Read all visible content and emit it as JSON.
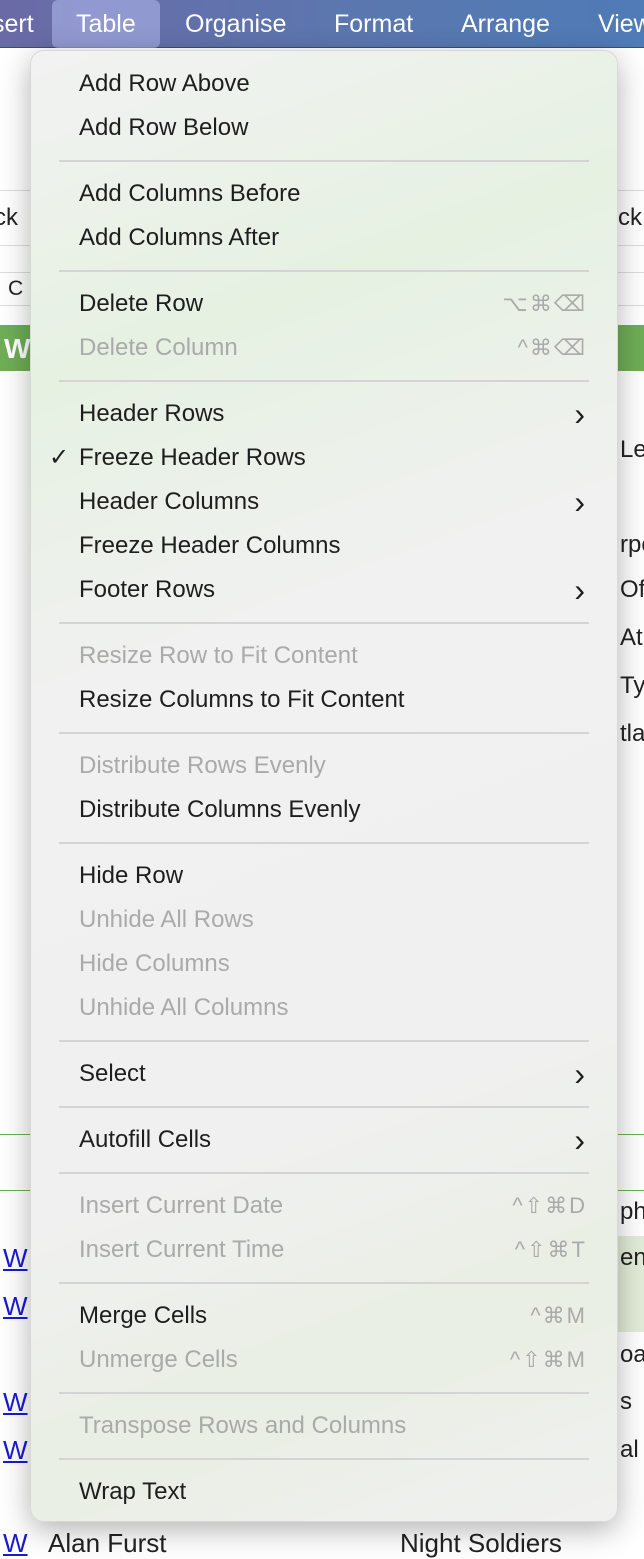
{
  "menubar": {
    "items": [
      {
        "label": "sert"
      },
      {
        "label": "Table",
        "active": true
      },
      {
        "label": "Organise"
      },
      {
        "label": "Format"
      },
      {
        "label": "Arrange"
      },
      {
        "label": "View"
      }
    ]
  },
  "background": {
    "left_fragments": [
      "ck",
      "C",
      "W"
    ],
    "right_fragments": [
      "ck",
      "Le",
      "rpo",
      "Of",
      "At",
      "Tyr",
      "tla",
      "ph",
      "en",
      "oa",
      "s",
      "al"
    ],
    "links": [
      "W",
      "W",
      "W",
      "W",
      "W"
    ],
    "last_row": {
      "author": "Alan Furst",
      "title": "Night Soldiers"
    },
    "accent": "#6fae56"
  },
  "menu": {
    "groups": [
      [
        {
          "label": "Add Row Above"
        },
        {
          "label": "Add Row Below"
        }
      ],
      [
        {
          "label": "Add Columns Before"
        },
        {
          "label": "Add Columns After"
        }
      ],
      [
        {
          "label": "Delete Row",
          "shortcut": "⌥⌘⌫"
        },
        {
          "label": "Delete Column",
          "shortcut": "^⌘⌫",
          "disabled": true
        }
      ],
      [
        {
          "label": "Header Rows",
          "submenu": true
        },
        {
          "label": "Freeze Header Rows",
          "checked": true
        },
        {
          "label": "Header Columns",
          "submenu": true
        },
        {
          "label": "Freeze Header Columns"
        },
        {
          "label": "Footer Rows",
          "submenu": true
        }
      ],
      [
        {
          "label": "Resize Row to Fit Content",
          "disabled": true
        },
        {
          "label": "Resize Columns to Fit Content"
        }
      ],
      [
        {
          "label": "Distribute Rows Evenly",
          "disabled": true
        },
        {
          "label": "Distribute Columns Evenly"
        }
      ],
      [
        {
          "label": "Hide Row"
        },
        {
          "label": "Unhide All Rows",
          "disabled": true
        },
        {
          "label": "Hide Columns",
          "disabled": true
        },
        {
          "label": "Unhide All Columns",
          "disabled": true
        }
      ],
      [
        {
          "label": "Select",
          "submenu": true
        }
      ],
      [
        {
          "label": "Autofill Cells",
          "submenu": true
        }
      ],
      [
        {
          "label": "Insert Current Date",
          "shortcut": "^⇧⌘D",
          "disabled": true
        },
        {
          "label": "Insert Current Time",
          "shortcut": "^⇧⌘T",
          "disabled": true
        }
      ],
      [
        {
          "label": "Merge Cells",
          "shortcut": "^⌘M"
        },
        {
          "label": "Unmerge Cells",
          "shortcut": "^⇧⌘M",
          "disabled": true
        }
      ],
      [
        {
          "label": "Transpose Rows and Columns",
          "disabled": true
        }
      ],
      [
        {
          "label": "Wrap Text"
        }
      ]
    ]
  }
}
